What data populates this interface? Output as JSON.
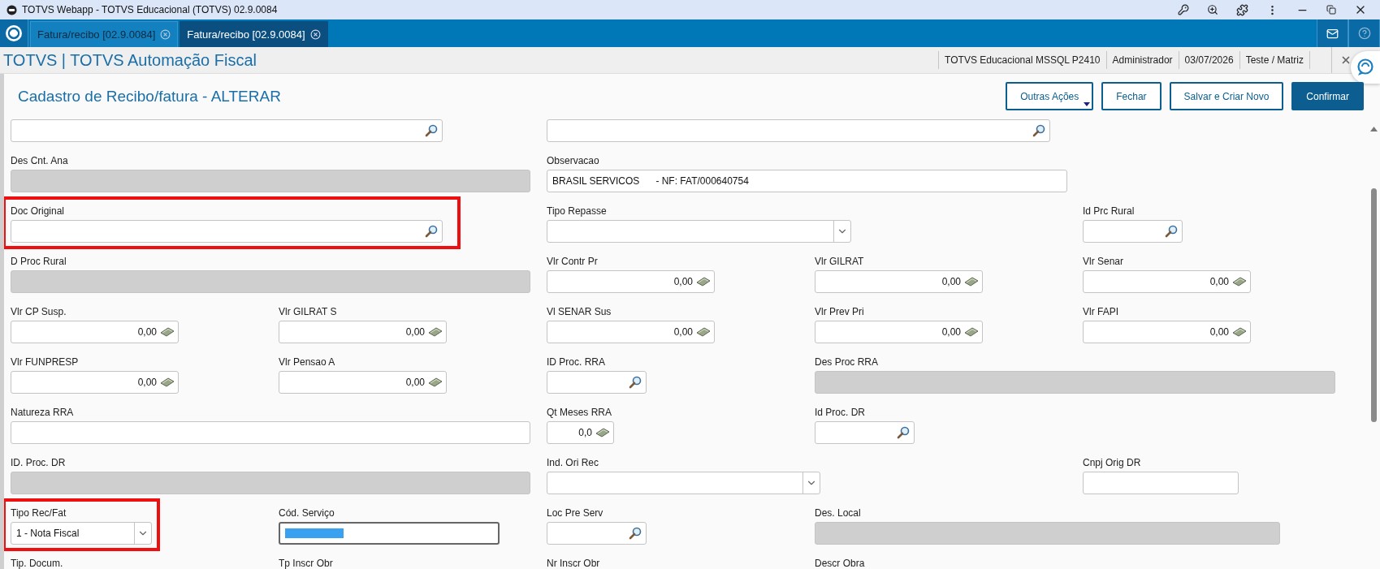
{
  "window": {
    "title": "TOTVS Webapp - TOTVS Educacional (TOTVS) 02.9.0084"
  },
  "tabs": [
    {
      "label": "Fatura/recibo [02.9.0084]",
      "selected": false
    },
    {
      "label": "Fatura/recibo [02.9.0084]",
      "selected": true
    }
  ],
  "app_header": {
    "title": "TOTVS | TOTVS Automação Fiscal",
    "info": [
      "TOTVS Educacional MSSQL P2410",
      "Administrador",
      "03/07/2026",
      "Teste / Matriz"
    ]
  },
  "page": {
    "title": "Cadastro de Recibo/fatura - ALTERAR",
    "buttons": [
      {
        "label": "Outras Ações",
        "kind": "menu"
      },
      {
        "label": "Fechar",
        "kind": "outline"
      },
      {
        "label": "Salvar e Criar Novo",
        "kind": "outline"
      },
      {
        "label": "Confirmar",
        "kind": "primary"
      }
    ]
  },
  "form": {
    "rows": [
      [
        {
          "kind": "search"
        },
        "",
        {
          "kind": "search"
        }
      ],
      [
        {
          "label": "Des Cnt. Ana",
          "kind": "readonly"
        },
        "",
        {
          "label": "Observacao",
          "kind": "text",
          "value": "BRASIL SERVICOS      - NF: FAT/000640754"
        }
      ],
      [
        {
          "label": "Doc Original",
          "kind": "search",
          "highlighted": true
        },
        "",
        {
          "label": "Tipo Repasse",
          "kind": "select"
        },
        "",
        {
          "label": "Id Prc Rural",
          "kind": "search"
        }
      ],
      [
        {
          "label": "D Proc Rural",
          "kind": "readonly"
        },
        "",
        {
          "label": "Vlr Contr Pr",
          "kind": "money",
          "value": "0,00"
        },
        {
          "label": "Vlr GILRAT",
          "kind": "money",
          "value": "0,00"
        },
        {
          "label": "Vlr Senar",
          "kind": "money",
          "value": "0,00"
        }
      ],
      [
        {
          "label": "Vlr CP Susp.",
          "kind": "money",
          "value": "0,00"
        },
        {
          "label": "Vlr GILRAT S",
          "kind": "money",
          "value": "0,00"
        },
        {
          "label": "Vl SENAR Sus",
          "kind": "money",
          "value": "0,00"
        },
        {
          "label": "Vlr Prev Pri",
          "kind": "money",
          "value": "0,00"
        },
        {
          "label": "Vlr FAPI",
          "kind": "money",
          "value": "0,00"
        }
      ],
      [
        {
          "label": "Vlr FUNPRESP",
          "kind": "money",
          "value": "0,00"
        },
        {
          "label": "Vlr Pensao A",
          "kind": "money",
          "value": "0,00"
        },
        {
          "label": "ID Proc. RRA",
          "kind": "search"
        },
        {
          "label": "Des Proc RRA",
          "kind": "readonly"
        }
      ],
      [
        {
          "label": "Natureza RRA",
          "kind": "text"
        },
        "",
        {
          "label": "Qt Meses RRA",
          "kind": "money",
          "value": "0,0"
        },
        {
          "label": "Id Proc. DR",
          "kind": "search"
        }
      ],
      [
        {
          "label": "ID. Proc. DR",
          "kind": "readonly"
        },
        "",
        {
          "label": "Ind. Ori Rec",
          "kind": "select"
        },
        "",
        {
          "label": "Cnpj Orig DR",
          "kind": "text"
        }
      ],
      [
        {
          "label": "Tipo Rec/Fat",
          "kind": "select",
          "value": "1 - Nota Fiscal",
          "highlighted": true
        },
        {
          "label": "Cód. Serviço",
          "kind": "text",
          "focused": true
        },
        {
          "label": "Loc Pre Serv",
          "kind": "search"
        },
        {
          "label": "Des. Local",
          "kind": "readonly"
        }
      ],
      [
        {
          "label": "Tip. Docum.",
          "kind": "label"
        },
        {
          "label": "Tp Inscr Obr",
          "kind": "label"
        },
        {
          "label": "Nr Inscr Obr",
          "kind": "label"
        },
        {
          "label": "Descr Obra",
          "kind": "label"
        }
      ]
    ]
  }
}
